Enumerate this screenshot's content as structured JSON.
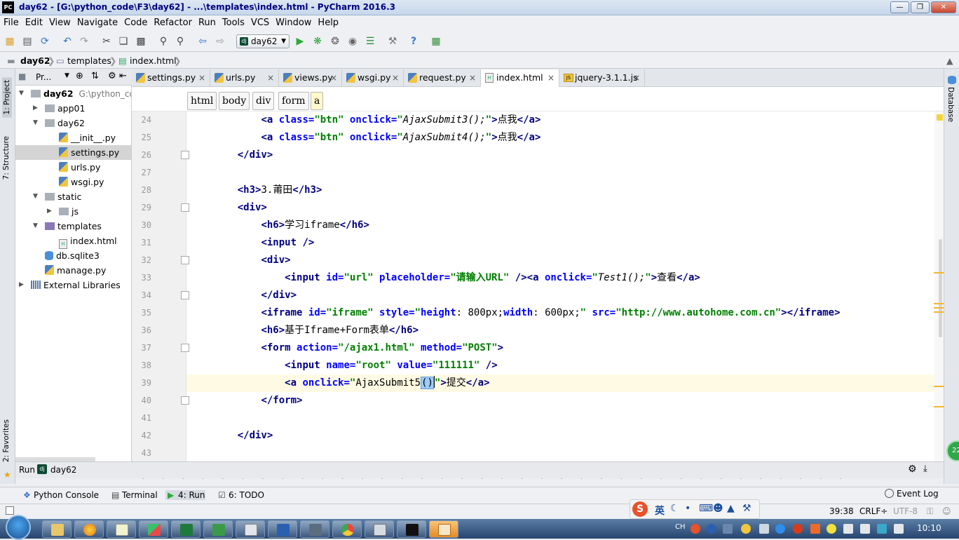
{
  "window": {
    "title": "day62 - [G:\\python_code\\F3\\day62] - ...\\templates\\index.html - PyCharm 2016.3",
    "app_icon_text": "PC"
  },
  "menu": [
    "File",
    "Edit",
    "View",
    "Navigate",
    "Code",
    "Refactor",
    "Run",
    "Tools",
    "VCS",
    "Window",
    "Help"
  ],
  "toolbar": {
    "run_config": "day62",
    "dj_badge": "dj"
  },
  "navbar": {
    "items": [
      "day62",
      "templates",
      "index.html"
    ]
  },
  "left_strip": {
    "project": "1: Project",
    "structure": "7: Structure",
    "favorites": "2: Favorites"
  },
  "right_strip": {
    "database": "Database"
  },
  "project_panel": {
    "header": "Pr..."
  },
  "tree": [
    {
      "label": "day62",
      "extra": "G:\\python_co",
      "indent": 0,
      "icon": "folder",
      "arrow": "down",
      "bold": true
    },
    {
      "label": "app01",
      "indent": 1,
      "icon": "folder",
      "arrow": "right"
    },
    {
      "label": "day62",
      "indent": 1,
      "icon": "folder",
      "arrow": "down"
    },
    {
      "label": "__init__.py",
      "indent": 2,
      "icon": "py"
    },
    {
      "label": "settings.py",
      "indent": 2,
      "icon": "py",
      "selected": true
    },
    {
      "label": "urls.py",
      "indent": 2,
      "icon": "py"
    },
    {
      "label": "wsgi.py",
      "indent": 2,
      "icon": "py"
    },
    {
      "label": "static",
      "indent": 1,
      "icon": "folder",
      "arrow": "down"
    },
    {
      "label": "js",
      "indent": 2,
      "icon": "folder",
      "arrow": "right"
    },
    {
      "label": "templates",
      "indent": 1,
      "icon": "folder-purple",
      "arrow": "down"
    },
    {
      "label": "index.html",
      "indent": 2,
      "icon": "html"
    },
    {
      "label": "db.sqlite3",
      "indent": 1,
      "icon": "db"
    },
    {
      "label": "manage.py",
      "indent": 1,
      "icon": "py"
    },
    {
      "label": "External Libraries",
      "indent": 0,
      "icon": "lib",
      "arrow": "right"
    }
  ],
  "tabs": [
    {
      "label": "settings.py",
      "icon": "py"
    },
    {
      "label": "urls.py",
      "icon": "py"
    },
    {
      "label": "views.py",
      "icon": "py"
    },
    {
      "label": "wsgi.py",
      "icon": "py"
    },
    {
      "label": "request.py",
      "icon": "py"
    },
    {
      "label": "index.html",
      "icon": "html",
      "active": true
    },
    {
      "label": "jquery-3.1.1.js",
      "icon": "js"
    }
  ],
  "breadcrumbs": [
    "html",
    "body",
    "div",
    "form",
    "a"
  ],
  "code": [
    {
      "n": "24",
      "ind": 2,
      "toks": [
        [
          "t",
          "<a "
        ],
        [
          "a",
          "class="
        ],
        [
          "v",
          "\"btn\" "
        ],
        [
          "a",
          "onclick="
        ],
        [
          "v",
          "\""
        ],
        [
          "s",
          "AjaxSubmit3();"
        ],
        [
          "v",
          "\""
        ],
        [
          "t",
          ">"
        ],
        [
          "tx",
          "点我"
        ],
        [
          "t",
          "</a>"
        ]
      ]
    },
    {
      "n": "25",
      "ind": 2,
      "toks": [
        [
          "t",
          "<a "
        ],
        [
          "a",
          "class="
        ],
        [
          "v",
          "\"btn\" "
        ],
        [
          "a",
          "onclick="
        ],
        [
          "v",
          "\""
        ],
        [
          "s",
          "AjaxSubmit4();"
        ],
        [
          "v",
          "\""
        ],
        [
          "t",
          ">"
        ],
        [
          "tx",
          "点我"
        ],
        [
          "t",
          "</a>"
        ]
      ]
    },
    {
      "n": "26",
      "ind": 1,
      "toks": [
        [
          "t",
          "</div>"
        ]
      ]
    },
    {
      "n": "27",
      "ind": 0,
      "toks": []
    },
    {
      "n": "28",
      "ind": 1,
      "toks": [
        [
          "t",
          "<h3>"
        ],
        [
          "tx",
          "3.莆田"
        ],
        [
          "t",
          "</h3>"
        ]
      ]
    },
    {
      "n": "29",
      "ind": 1,
      "toks": [
        [
          "t",
          "<div>"
        ]
      ]
    },
    {
      "n": "30",
      "ind": 2,
      "toks": [
        [
          "t",
          "<h6>"
        ],
        [
          "tx",
          "学习iframe"
        ],
        [
          "t",
          "</h6>"
        ]
      ]
    },
    {
      "n": "31",
      "ind": 2,
      "toks": [
        [
          "t",
          "<input />"
        ]
      ]
    },
    {
      "n": "32",
      "ind": 2,
      "toks": [
        [
          "t",
          "<div>"
        ]
      ]
    },
    {
      "n": "33",
      "ind": 3,
      "toks": [
        [
          "t",
          "<input "
        ],
        [
          "a",
          "id="
        ],
        [
          "v",
          "\"url\" "
        ],
        [
          "a",
          "placeholder="
        ],
        [
          "v",
          "\"请输入URL\" "
        ],
        [
          "t",
          "/><a "
        ],
        [
          "a",
          "onclick="
        ],
        [
          "v",
          "\""
        ],
        [
          "s",
          "Test1();"
        ],
        [
          "v",
          "\""
        ],
        [
          "t",
          ">"
        ],
        [
          "tx",
          "查看"
        ],
        [
          "t",
          "</a>"
        ]
      ]
    },
    {
      "n": "34",
      "ind": 2,
      "toks": [
        [
          "t",
          "</div>"
        ]
      ]
    },
    {
      "n": "35",
      "ind": 2,
      "toks": [
        [
          "t",
          "<iframe "
        ],
        [
          "a",
          "id="
        ],
        [
          "v",
          "\"iframe\" "
        ],
        [
          "a",
          "style="
        ],
        [
          "v",
          "\""
        ],
        [
          "a",
          "height"
        ],
        [
          "tx",
          ": 800px;"
        ],
        [
          "a",
          "width"
        ],
        [
          "tx",
          ": 600px;"
        ],
        [
          "v",
          "\" "
        ],
        [
          "a",
          "src="
        ],
        [
          "v",
          "\"http://www.autohome.com.cn\""
        ],
        [
          "t",
          "></iframe>"
        ]
      ]
    },
    {
      "n": "36",
      "ind": 2,
      "toks": [
        [
          "t",
          "<h6>"
        ],
        [
          "tx",
          "基于Iframe+Form表单"
        ],
        [
          "t",
          "</h6>"
        ]
      ]
    },
    {
      "n": "37",
      "ind": 2,
      "toks": [
        [
          "t",
          "<form "
        ],
        [
          "a",
          "action="
        ],
        [
          "v",
          "\"/ajax1.html\" "
        ],
        [
          "a",
          "method="
        ],
        [
          "v",
          "\"POST\""
        ],
        [
          "t",
          ">"
        ]
      ]
    },
    {
      "n": "38",
      "ind": 3,
      "toks": [
        [
          "t",
          "<input "
        ],
        [
          "a",
          "name="
        ],
        [
          "v",
          "\"root\" "
        ],
        [
          "a",
          "value="
        ],
        [
          "v",
          "\"111111\" "
        ],
        [
          "t",
          "/>"
        ]
      ]
    },
    {
      "n": "39",
      "ind": 3,
      "cur": true,
      "toks": [
        [
          "t",
          "<a "
        ],
        [
          "a",
          "onclick="
        ],
        [
          "v",
          "\""
        ],
        [
          "tx",
          "AjaxSubmit5"
        ],
        [
          "hl",
          "()"
        ],
        [
          "caret",
          ""
        ],
        [
          "v",
          "\""
        ],
        [
          "t",
          ">"
        ],
        [
          "tx",
          "提交"
        ],
        [
          "t",
          "</a>"
        ]
      ]
    },
    {
      "n": "40",
      "ind": 2,
      "toks": [
        [
          "t",
          "</form>"
        ]
      ]
    },
    {
      "n": "41",
      "ind": 0,
      "toks": []
    },
    {
      "n": "42",
      "ind": 1,
      "toks": [
        [
          "t",
          "</div>"
        ]
      ]
    },
    {
      "n": "43",
      "ind": 0,
      "toks": []
    }
  ],
  "run_panel": {
    "label": "Run",
    "config": "day62"
  },
  "bottom_tabs": [
    {
      "label": "Python Console"
    },
    {
      "label": "Terminal"
    },
    {
      "label": "4: Run",
      "active": true
    },
    {
      "label": "6: TODO"
    }
  ],
  "event_log": "Event Log",
  "status": {
    "position": "39:38",
    "line_sep": "CRLF÷",
    "encoding": "UTF-8"
  },
  "ime": {
    "lang": "英"
  },
  "taskbar": {
    "lang": "CH",
    "clock": "10:10",
    "bubble": "22"
  },
  "colors": {
    "tag": "#000080",
    "attr": "#0000ff",
    "value": "#008000",
    "accent": "#f2b82c"
  }
}
